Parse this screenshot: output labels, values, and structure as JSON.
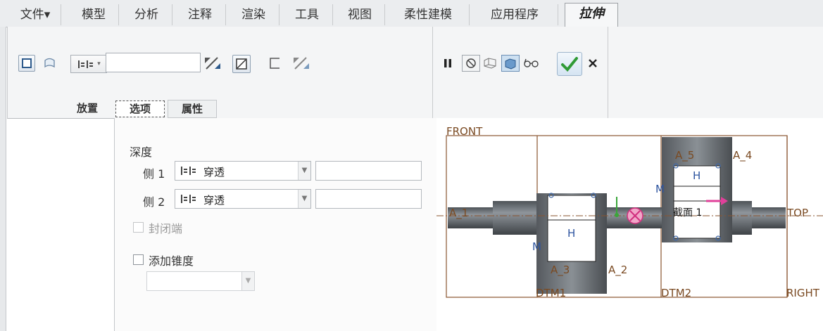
{
  "menubar": {
    "tabs": [
      {
        "label": "文件▾"
      },
      {
        "label": "模型"
      },
      {
        "label": "分析"
      },
      {
        "label": "注释"
      },
      {
        "label": "渲染"
      },
      {
        "label": "工具"
      },
      {
        "label": "视图"
      },
      {
        "label": "柔性建模"
      },
      {
        "label": "应用程序"
      },
      {
        "label": "拉伸"
      }
    ]
  },
  "ribbon": {
    "depth_value": "",
    "subtabs": [
      "放置",
      "选项",
      "属性"
    ]
  },
  "options": {
    "depth_title": "深度",
    "side1_label": "侧 1",
    "side1_value": "穿透",
    "side2_label": "侧 2",
    "side2_value": "穿透",
    "capped_ends": "封闭端",
    "add_taper": "添加锥度",
    "taper_value": ""
  },
  "viewport": {
    "labels": {
      "front": "FRONT",
      "top": "TOP",
      "right": "RIGHT",
      "dtm1": "DTM1",
      "dtm2": "DTM2",
      "a1": "A_1",
      "a2": "A_2",
      "a3": "A_3",
      "a4": "A_4",
      "a5": "A_5",
      "h1": "H",
      "h2": "H",
      "m1": "M",
      "m2": "M",
      "section": "截面 1"
    }
  },
  "colors": {
    "accent_green": "#3aa63a",
    "datum_brown": "#8a5530",
    "part_gray": "#6b6f74",
    "arrow_pink": "#e0409a"
  }
}
